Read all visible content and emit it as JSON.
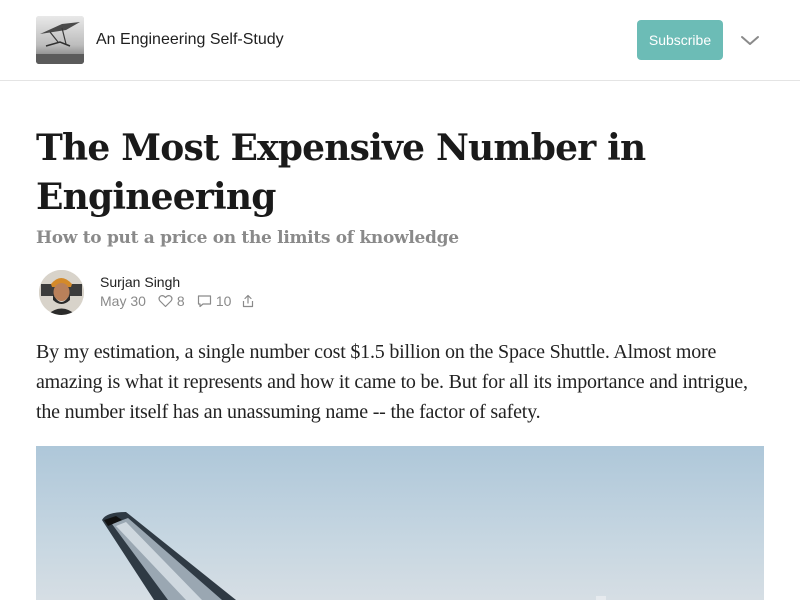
{
  "header": {
    "publication_name": "An Engineering Self-Study",
    "subscribe_label": "Subscribe",
    "logo_icon": "glider-photo-logo",
    "menu_icon": "chevron-down-icon"
  },
  "post": {
    "title": "The Most Expensive Number in Engineering",
    "subtitle": "How to put a price on the limits of knowledge",
    "author": "Surjan Singh",
    "date": "May 30",
    "likes": "8",
    "comments": "10",
    "intro": "By my estimation, a single number cost $1.5 billion on the Space Shuttle. Almost more amazing is what it represents and how it came to be. But for all its importance and intrigue, the number itself has an unassuming name -- the factor of safety.",
    "hero_image": "space-shuttle-tail-photo"
  },
  "colors": {
    "accent": "#6cbcb6",
    "muted": "#8a8a8a",
    "text": "#222222",
    "divider": "#e4e4e4"
  }
}
